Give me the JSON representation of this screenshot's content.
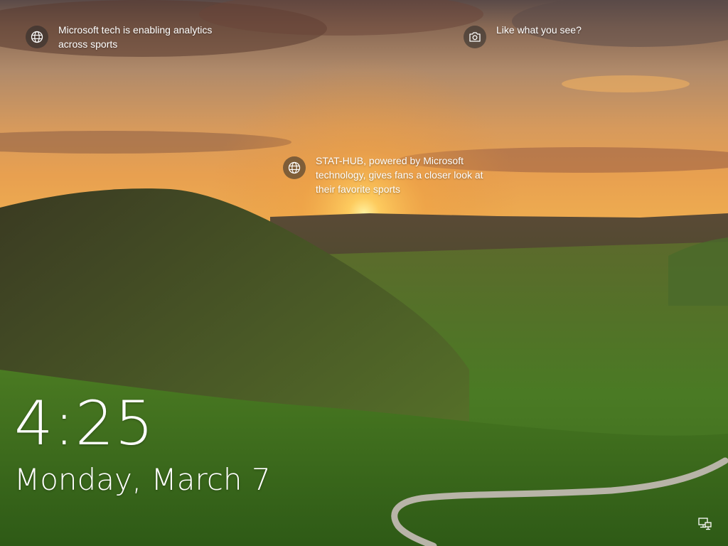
{
  "lockscreen": {
    "spotlight": [
      {
        "icon": "globe-icon",
        "text": "Microsoft tech is enabling analytics\nacross sports"
      },
      {
        "icon": "camera-icon",
        "text": "Like what you see?"
      },
      {
        "icon": "globe-icon",
        "text": "STAT-HUB, powered by Microsoft\ntechnology, gives fans a closer look at\ntheir favorite sports"
      }
    ],
    "time": "4:25",
    "date": "Monday, March 7",
    "status_icon": "network-icon"
  }
}
